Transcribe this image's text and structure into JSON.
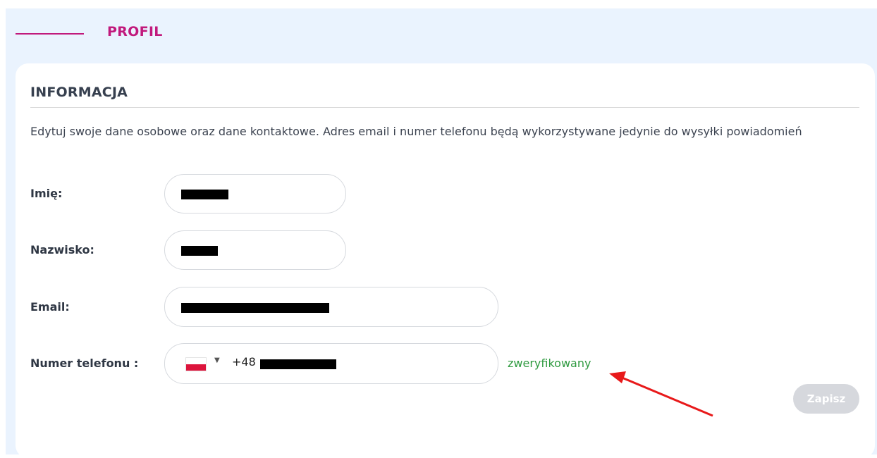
{
  "header": {
    "title": "PROFIL",
    "accent_color": "#c1197c"
  },
  "info": {
    "title": "INFORMACJA",
    "description": "Edytuj swoje dane osobowe oraz dane kontaktowe. Adres email i numer telefonu będą wykorzystywane jedynie do wysyłki powiadomień"
  },
  "form": {
    "first_name": {
      "label": "Imię:",
      "value": ""
    },
    "last_name": {
      "label": "Nazwisko:",
      "value": ""
    },
    "email": {
      "label": "Email:",
      "value": ""
    },
    "phone": {
      "label": "Numer telefonu :",
      "country_flag": "poland-flag-icon",
      "dial_code": "+48",
      "value": "",
      "status": "zweryfikowany",
      "status_color": "#2e9a3f"
    }
  },
  "actions": {
    "save_label": "Zapisz"
  },
  "annotation": {
    "arrow_color": "#e8191a"
  }
}
